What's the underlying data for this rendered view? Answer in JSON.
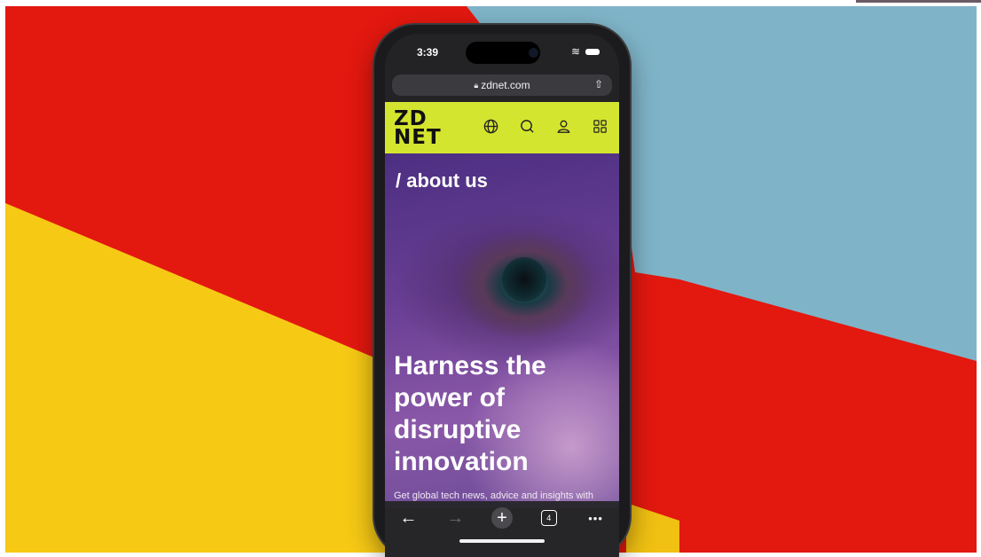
{
  "status": {
    "time": "3:39"
  },
  "browser": {
    "url": "zdnet.com",
    "tab_count": "4"
  },
  "site": {
    "logo": "ZD\nNET",
    "brand_color": "#D4E52F",
    "nav_icons": [
      "globe-icon",
      "search-icon",
      "user-icon",
      "grid-icon"
    ]
  },
  "hero": {
    "kicker": "/ about us",
    "title": "Harness the power of disruptive innovation",
    "subtitle": "Get global tech news, advice and insights with"
  },
  "toolbar": {
    "back": "←",
    "forward": "→",
    "new_tab": "+",
    "more": "•••"
  },
  "colors": {
    "red": "#E3180F",
    "yellow": "#F6C915",
    "blue": "#7FB4C8",
    "phone": "#1B1B1D"
  }
}
